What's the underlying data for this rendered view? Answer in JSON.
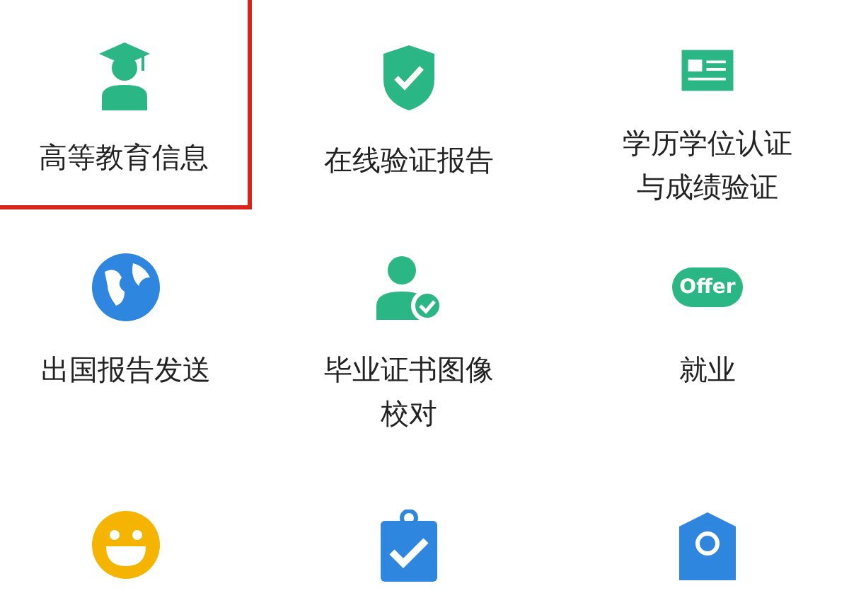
{
  "items": [
    {
      "kind": "graduate",
      "label": "高等教育信息",
      "highlighted": true
    },
    {
      "kind": "shield",
      "label": "在线验证报告",
      "highlighted": false
    },
    {
      "kind": "card",
      "label": "学历学位认证与成绩验证",
      "highlighted": false
    },
    {
      "kind": "globe",
      "label": "出国报告发送",
      "highlighted": false
    },
    {
      "kind": "person-check",
      "label": "毕业证书图像校对",
      "highlighted": false
    },
    {
      "kind": "offer",
      "icon_text": "Offer",
      "label": "就业",
      "highlighted": false
    },
    {
      "kind": "smiley",
      "highlighted": false
    },
    {
      "kind": "clipboard",
      "highlighted": false
    },
    {
      "kind": "badge",
      "highlighted": false
    }
  ]
}
